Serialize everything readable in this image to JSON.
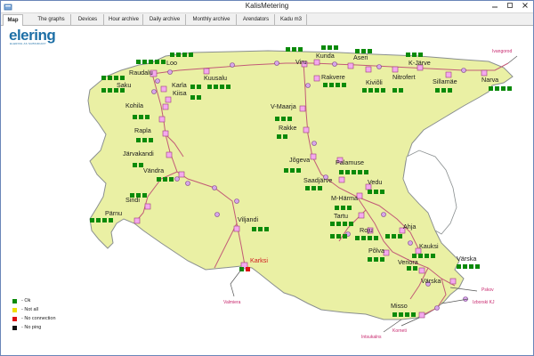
{
  "window": {
    "title": "KalisMetering"
  },
  "tabs": [
    {
      "label": "Map",
      "active": true
    },
    {
      "label": "The graphs"
    },
    {
      "label": "Devices"
    },
    {
      "label": "Hour archive"
    },
    {
      "label": "Daily archive"
    },
    {
      "label": "Monthly archive"
    },
    {
      "label": "Arendators"
    },
    {
      "label": "Kadu m3"
    }
  ],
  "logo": {
    "name": "elering",
    "subtitle": "ELERING AS SUBSIDIARY"
  },
  "colors": {
    "map_fill": "#eaf0a4",
    "map_border": "#8a8f90",
    "line": "#c25b77",
    "node_fill": "#f4a9ee",
    "ok": "#0a8a0a",
    "not_all": "#f0e000",
    "no_connection": "#dc1010",
    "no_ping": "#111111"
  },
  "map": {
    "stations": [
      {
        "name": "Loo"
      },
      {
        "name": "Raudalu"
      },
      {
        "name": "Saku"
      },
      {
        "name": "Karla"
      },
      {
        "name": "Kiisa"
      },
      {
        "name": "Kuusalu"
      },
      {
        "name": "Viru"
      },
      {
        "name": "Kunda"
      },
      {
        "name": "Aseri"
      },
      {
        "name": "Rakvere"
      },
      {
        "name": "Kiviõli"
      },
      {
        "name": "Nitrofert"
      },
      {
        "name": "K-Järve"
      },
      {
        "name": "Sillamäe"
      },
      {
        "name": "Narva"
      },
      {
        "name": "Kohila"
      },
      {
        "name": "Rapla"
      },
      {
        "name": "Järvakandi"
      },
      {
        "name": "Vändra"
      },
      {
        "name": "Sindi"
      },
      {
        "name": "Pärnu"
      },
      {
        "name": "Viljandi"
      },
      {
        "name": "Karksi"
      },
      {
        "name": "V-Maarja"
      },
      {
        "name": "Rakke"
      },
      {
        "name": "Jõgeva"
      },
      {
        "name": "Palamuse"
      },
      {
        "name": "Saadjärve"
      },
      {
        "name": "Vedu"
      },
      {
        "name": "M-Härma"
      },
      {
        "name": "Tartu"
      },
      {
        "name": "Roju"
      },
      {
        "name": "Ahja"
      },
      {
        "name": "Põlva"
      },
      {
        "name": "Kauksi"
      },
      {
        "name": "Veriora"
      },
      {
        "name": "Värska"
      },
      {
        "name": "Misso"
      }
    ],
    "border_points": [
      "Ivangorod",
      "Valmiera",
      "Pskov",
      "Izborski KJ",
      "Korneti",
      "Intsukalns"
    ]
  },
  "legend": [
    {
      "label": "- Ok",
      "color": "#0a8a0a"
    },
    {
      "label": "- Not all",
      "color": "#f0e000"
    },
    {
      "label": "- No connection",
      "color": "#dc1010"
    },
    {
      "label": "- No ping",
      "color": "#111111"
    }
  ]
}
